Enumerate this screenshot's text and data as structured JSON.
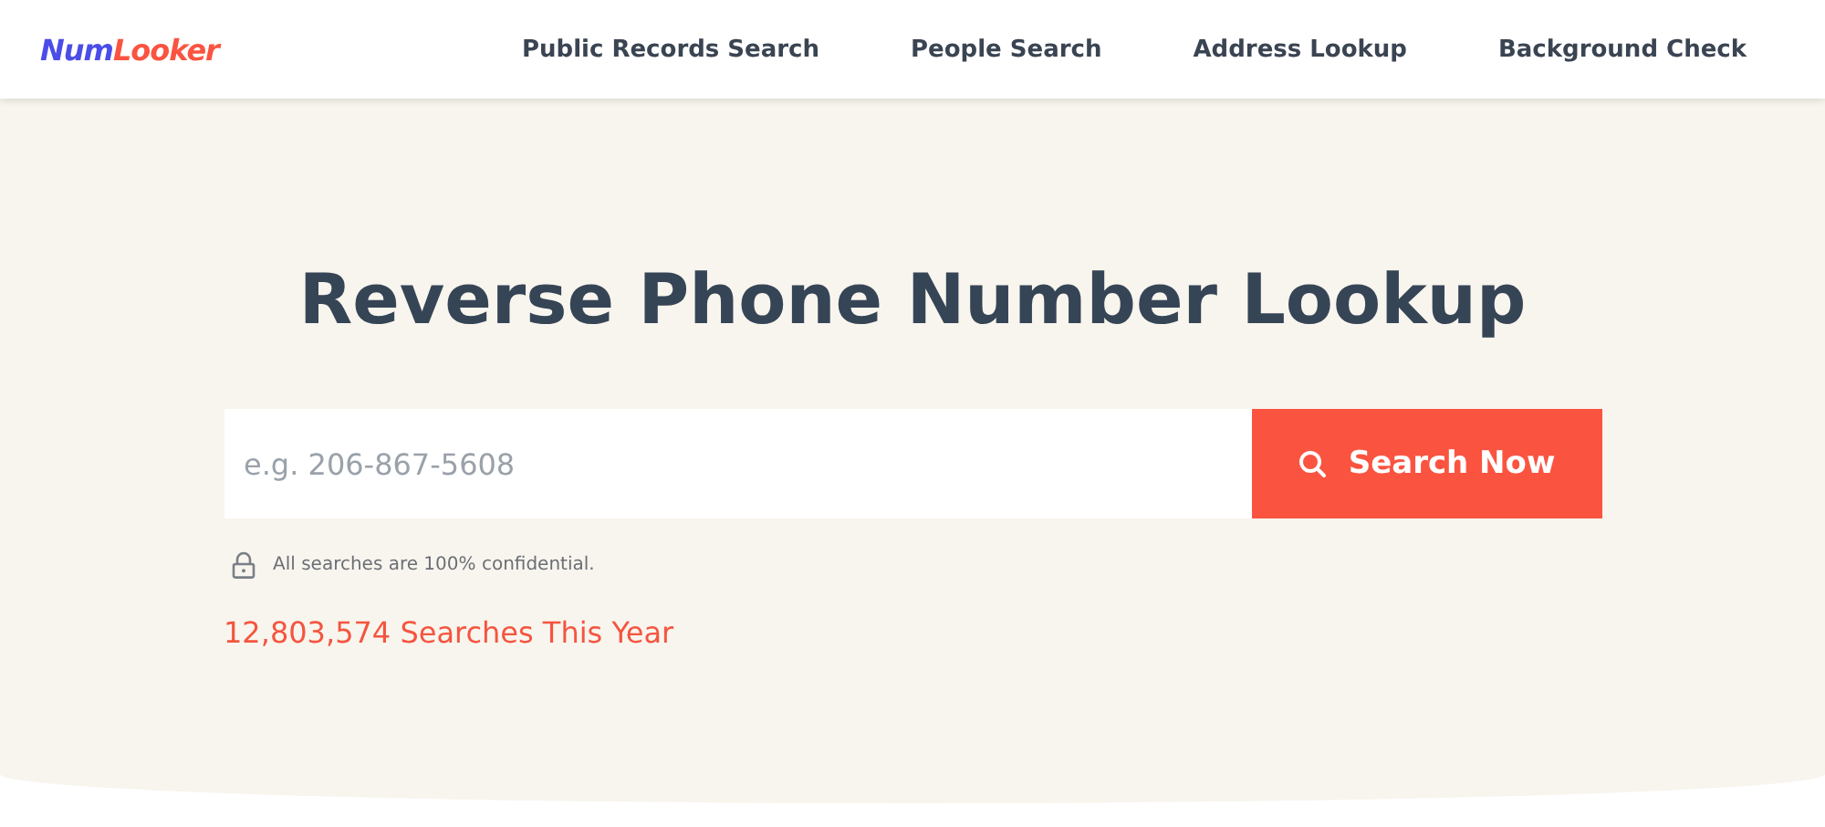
{
  "logo": {
    "primary": "Num",
    "accent": "Looker"
  },
  "nav": [
    "Public Records Search",
    "People Search",
    "Address Lookup",
    "Background Check"
  ],
  "hero": {
    "title": "Reverse Phone Number Lookup",
    "search": {
      "placeholder": "e.g. 206-867-5608",
      "button": "Search Now"
    },
    "note": "All searches are 100% confidential.",
    "count": "12,803,574 Searches This Year"
  }
}
